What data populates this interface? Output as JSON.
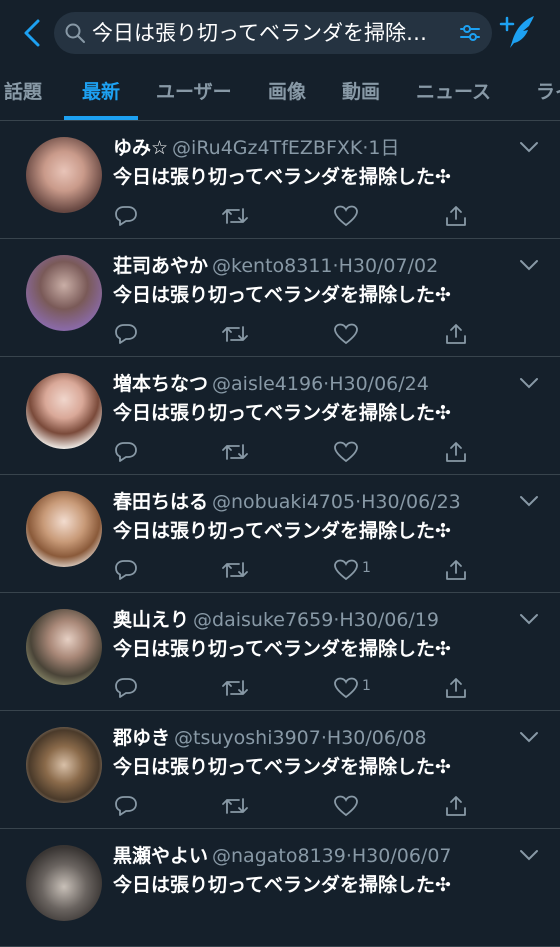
{
  "search": {
    "query": "今日は張り切ってベランダを掃除…"
  },
  "tabs": [
    {
      "label": "話題"
    },
    {
      "label": "最新"
    },
    {
      "label": "ユーザー"
    },
    {
      "label": "画像"
    },
    {
      "label": "動画"
    },
    {
      "label": "ニュース"
    },
    {
      "label": "ライ"
    }
  ],
  "active_tab": "最新",
  "colors": {
    "background": "#15202b",
    "accent": "#1da1f2",
    "muted": "#8899a6",
    "divider": "#38444d"
  },
  "tweets": [
    {
      "name": "ゆみ☆",
      "handle": "@iRu4Gz4TfEZBFXK",
      "date": "1日",
      "text": "今日は張り切ってベランダを掃除した✣",
      "likes": ""
    },
    {
      "name": "荘司あやか",
      "handle": "@kento8311",
      "date": "H30/07/02",
      "text": "今日は張り切ってベランダを掃除した✣",
      "likes": ""
    },
    {
      "name": "増本ちなつ",
      "handle": "@aisle4196",
      "date": "H30/06/24",
      "text": "今日は張り切ってベランダを掃除した✣",
      "likes": ""
    },
    {
      "name": "春田ちはる",
      "handle": "@nobuaki4705",
      "date": "H30/06/23",
      "text": "今日は張り切ってベランダを掃除した✣",
      "likes": "1"
    },
    {
      "name": "奥山えり",
      "handle": "@daisuke7659",
      "date": "H30/06/19",
      "text": "今日は張り切ってベランダを掃除した✣",
      "likes": "1"
    },
    {
      "name": "郡ゆき",
      "handle": "@tsuyoshi3907",
      "date": "H30/06/08",
      "text": "今日は張り切ってベランダを掃除した✣",
      "likes": ""
    },
    {
      "name": "黒瀬やよい",
      "handle": "@nagato8139",
      "date": "H30/06/07",
      "text": "今日は張り切ってベランダを掃除した✣",
      "likes": ""
    }
  ],
  "icons": {
    "back": "chevron-left-icon",
    "search": "search-icon",
    "filter": "filter-sliders-icon",
    "compose": "compose-tweet-icon",
    "reply": "reply-icon",
    "retweet": "retweet-icon",
    "like": "heart-icon",
    "share": "share-icon",
    "more": "chevron-down-icon"
  }
}
